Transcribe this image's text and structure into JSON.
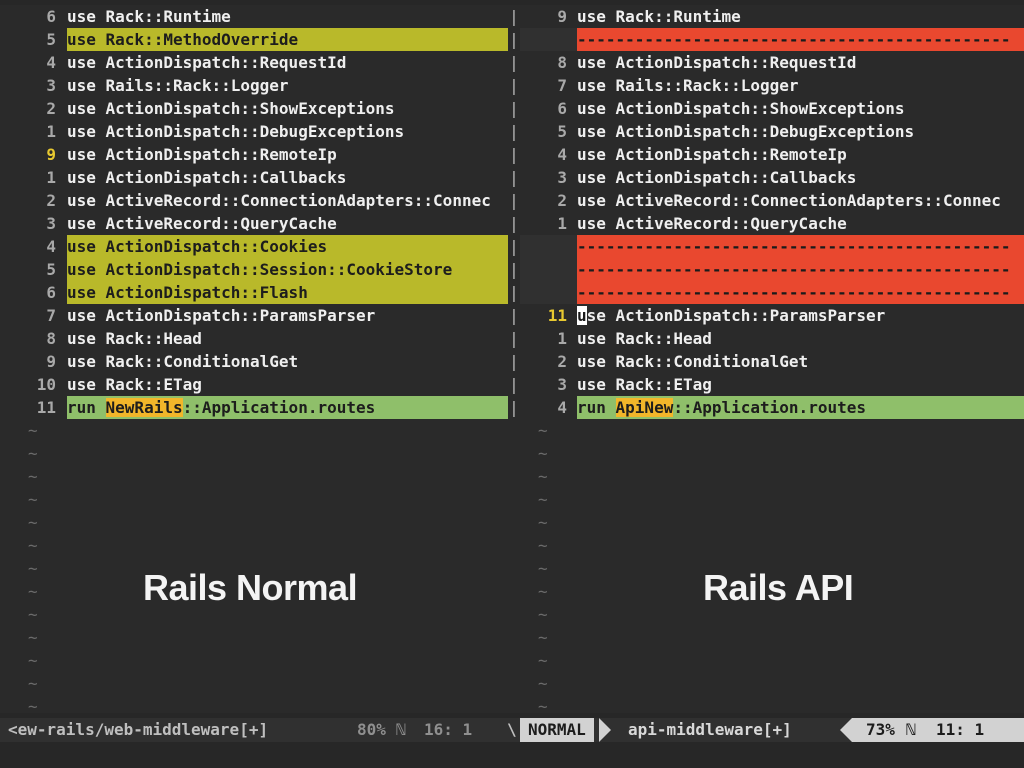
{
  "left": {
    "caption": "Rails Normal",
    "lines": [
      {
        "num": "6",
        "code": "use Rack::Runtime",
        "style": ""
      },
      {
        "num": "5",
        "code": "use Rack::MethodOverride",
        "style": "change"
      },
      {
        "num": "4",
        "code": "use ActionDispatch::RequestId",
        "style": ""
      },
      {
        "num": "3",
        "code": "use Rails::Rack::Logger",
        "style": ""
      },
      {
        "num": "2",
        "code": "use ActionDispatch::ShowExceptions",
        "style": ""
      },
      {
        "num": "1",
        "code": "use ActionDispatch::DebugExceptions",
        "style": ""
      },
      {
        "num": "9",
        "code": "use ActionDispatch::RemoteIp",
        "style": "",
        "current": true
      },
      {
        "num": "1",
        "code": "use ActionDispatch::Callbacks",
        "style": ""
      },
      {
        "num": "2",
        "code": "use ActiveRecord::ConnectionAdapters::Connec",
        "style": ""
      },
      {
        "num": "3",
        "code": "use ActiveRecord::QueryCache",
        "style": ""
      },
      {
        "num": "4",
        "code": "use ActionDispatch::Cookies",
        "style": "change"
      },
      {
        "num": "5",
        "code": "use ActionDispatch::Session::CookieStore",
        "style": "change"
      },
      {
        "num": "6",
        "code": "use ActionDispatch::Flash",
        "style": "change"
      },
      {
        "num": "7",
        "code": "use ActionDispatch::ParamsParser",
        "style": ""
      },
      {
        "num": "8",
        "code": "use Rack::Head",
        "style": ""
      },
      {
        "num": "9",
        "code": "use Rack::ConditionalGet",
        "style": ""
      },
      {
        "num": "10",
        "code": "use Rack::ETag",
        "style": ""
      },
      {
        "num": "11",
        "code": "",
        "style": "add",
        "pre": "run ",
        "word": "NewRails",
        "post": "::Application.routes"
      }
    ],
    "tildes": 13,
    "status": {
      "file": "<ew-rails/web-middleware[+]",
      "percent": "80%",
      "line_icon": "ℕ",
      "line": "16:",
      "col": "1"
    }
  },
  "right": {
    "caption": "Rails API",
    "lines": [
      {
        "num": "9",
        "code": "use Rack::Runtime",
        "style": ""
      },
      {
        "num": "",
        "code": "---------------------------------------------",
        "style": "del",
        "filler": true
      },
      {
        "num": "8",
        "code": "use ActionDispatch::RequestId",
        "style": ""
      },
      {
        "num": "7",
        "code": "use Rails::Rack::Logger",
        "style": ""
      },
      {
        "num": "6",
        "code": "use ActionDispatch::ShowExceptions",
        "style": ""
      },
      {
        "num": "5",
        "code": "use ActionDispatch::DebugExceptions",
        "style": ""
      },
      {
        "num": "4",
        "code": "use ActionDispatch::RemoteIp",
        "style": ""
      },
      {
        "num": "3",
        "code": "use ActionDispatch::Callbacks",
        "style": ""
      },
      {
        "num": "2",
        "code": "use ActiveRecord::ConnectionAdapters::Connec",
        "style": ""
      },
      {
        "num": "1",
        "code": "use ActiveRecord::QueryCache",
        "style": ""
      },
      {
        "num": "",
        "code": "---------------------------------------------",
        "style": "del",
        "filler": true
      },
      {
        "num": "",
        "code": "---------------------------------------------",
        "style": "del",
        "filler": true
      },
      {
        "num": "",
        "code": "---------------------------------------------",
        "style": "del",
        "filler": true
      },
      {
        "num": "11",
        "code": "",
        "style": "",
        "current": true,
        "cursor": "u",
        "post": "se ActionDispatch::ParamsParser"
      },
      {
        "num": "1",
        "code": "use Rack::Head",
        "style": ""
      },
      {
        "num": "2",
        "code": "use Rack::ConditionalGet",
        "style": ""
      },
      {
        "num": "3",
        "code": "use Rack::ETag",
        "style": ""
      },
      {
        "num": "4",
        "code": "",
        "style": "add",
        "pre": "run ",
        "word": "ApiNew",
        "post": "::Application.routes"
      }
    ],
    "tildes": 13,
    "status": {
      "mode": "NORMAL",
      "file": "api-middleware[+]",
      "percent": "73%",
      "line_icon": "ℕ",
      "line": "11:",
      "col": "1"
    }
  },
  "separator_glyph": "|",
  "tilde_glyph": "~",
  "status_separator": "\\",
  "colors": {
    "background": "#272727",
    "change": "#b9b92a",
    "add": "#8fbf6a",
    "delete": "#e9482f",
    "word_highlight": "#f2b62a",
    "current_line_number": "#e8c930"
  }
}
